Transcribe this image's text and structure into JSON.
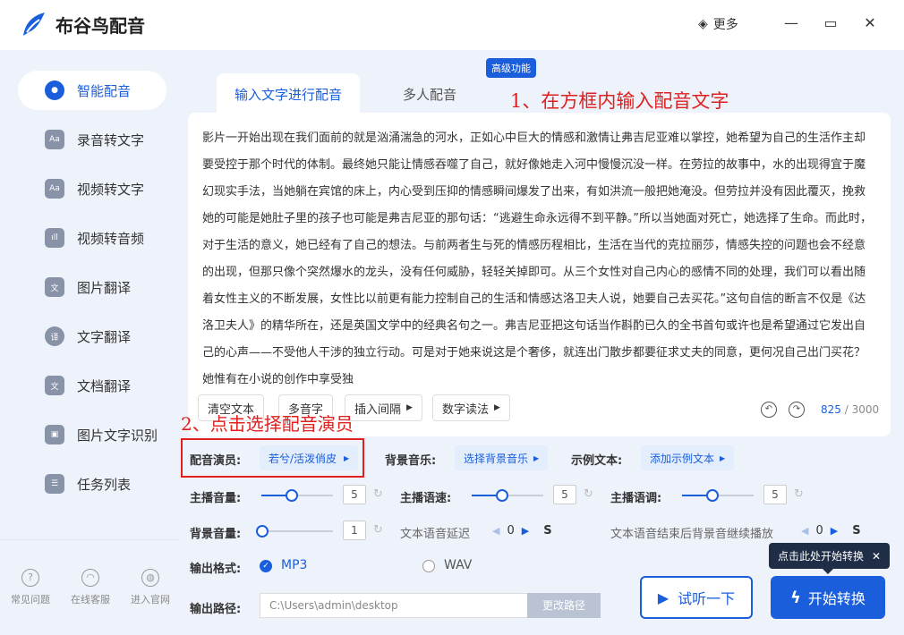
{
  "app": {
    "title": "布谷鸟配音",
    "more_label": "更多"
  },
  "sidebar": {
    "items": [
      {
        "label": "智能配音"
      },
      {
        "label": "录音转文字"
      },
      {
        "label": "视频转文字"
      },
      {
        "label": "视频转音频"
      },
      {
        "label": "图片翻译"
      },
      {
        "label": "文字翻译"
      },
      {
        "label": "文档翻译"
      },
      {
        "label": "图片文字识别"
      },
      {
        "label": "任务列表"
      }
    ],
    "footer": [
      {
        "label": "常见问题"
      },
      {
        "label": "在线客服"
      },
      {
        "label": "进入官网"
      }
    ]
  },
  "tabs": {
    "input": "输入文字进行配音",
    "multi": "多人配音",
    "badge": "高级功能"
  },
  "annotations": {
    "step1": "1、在方框内输入配音文字",
    "step2": "2、点击选择配音演员"
  },
  "editor": {
    "text": "影片一开始出现在我们面前的就是汹涌湍急的河水，正如心中巨大的情感和激情让弗吉尼亚难以掌控，她希望为自己的生活作主却要受控于那个时代的体制。最终她只能让情感吞噬了自己，就好像她走入河中慢慢沉没一样。在劳拉的故事中，水的出现得宜于魔幻现实手法，当她躺在宾馆的床上，内心受到压抑的情感瞬间爆发了出来，有如洪流一般把她淹没。但劳拉并没有因此覆灭，挽救她的可能是她肚子里的孩子也可能是弗吉尼亚的那句话：“逃避生命永远得不到平静。”所以当她面对死亡，她选择了生命。而此时，对于生活的意义，她已经有了自己的想法。与前两者生与死的情感历程相比，生活在当代的克拉丽莎，情感失控的问题也会不经意的出现，但那只像个突然爆水的龙头，没有任何威胁，轻轻关掉即可。从三个女性对自己内心的感情不同的处理，我们可以看出随着女性主义的不断发展，女性比以前更有能力控制自己的生活和情感达洛卫夫人说，她要自己去买花。”这句自信的断言不仅是《达洛卫夫人》的精华所在，还是英国文学中的经典名句之一。弗吉尼亚把这句话当作斟酌已久的全书首句或许也是希望通过它发出自己的心声——不受他人干涉的独立行动。可是对于她来说这是个奢侈，就连出门散步都要征求丈夫的同意，更何况自己出门买花？她惟有在小说的创作中享受独",
    "buttons": {
      "clear": "清空文本",
      "polyphone": "多音字",
      "pause": "插入间隔",
      "digits": "数字读法"
    },
    "count_current": "825",
    "count_max": "/ 3000"
  },
  "settings": {
    "actor_label": "配音演员:",
    "actor_value": "若兮/活泼俏皮",
    "bgm_label": "背景音乐:",
    "bgm_value": "选择背景音乐",
    "sample_label": "示例文本:",
    "sample_value": "添加示例文本",
    "volume_label": "主播音量:",
    "volume_value": "5",
    "speed_label": "主播语速:",
    "speed_value": "5",
    "pitch_label": "主播语调:",
    "pitch_value": "5",
    "bg_volume_label": "背景音量:",
    "bg_volume_value": "1",
    "delay_label": "文本语音延迟",
    "delay_value": "0",
    "delay_unit": "S",
    "after_label": "文本语音结束后背景音继续播放",
    "after_value": "0",
    "after_unit": "S",
    "format_label": "输出格式:",
    "format_mp3": "MP3",
    "format_wav": "WAV",
    "path_label": "输出路径:",
    "path_value": "C:\\Users\\admin\\desktop",
    "path_button": "更改路径"
  },
  "actions": {
    "listen": "试听一下",
    "start": "开始转换",
    "tooltip": "点击此处开始转换"
  },
  "colors": {
    "accent": "#1a5edb",
    "annotation": "#e02020",
    "tooltip_bg": "#1f2e46"
  }
}
